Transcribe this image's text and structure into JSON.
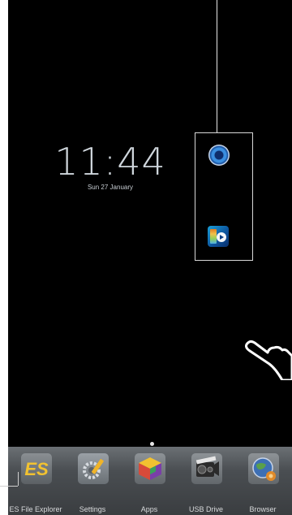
{
  "lockscreen": {
    "time": "11:44",
    "date": "Sun 27 January"
  },
  "widgets": [
    {
      "name": "speaker-icon"
    },
    {
      "name": "media-player-icon"
    }
  ],
  "dock": {
    "items": [
      {
        "label": "ES File Explorer",
        "icon": "es-file-explorer-icon"
      },
      {
        "label": "Settings",
        "icon": "settings-icon"
      },
      {
        "label": "Apps",
        "icon": "apps-icon"
      },
      {
        "label": "USB Drive",
        "icon": "usb-drive-icon"
      },
      {
        "label": "Browser",
        "icon": "browser-icon"
      }
    ]
  },
  "colors": {
    "screen_bg": "#000000",
    "dock_bg": "#4a4e52",
    "callout": "#d8d8d8"
  }
}
